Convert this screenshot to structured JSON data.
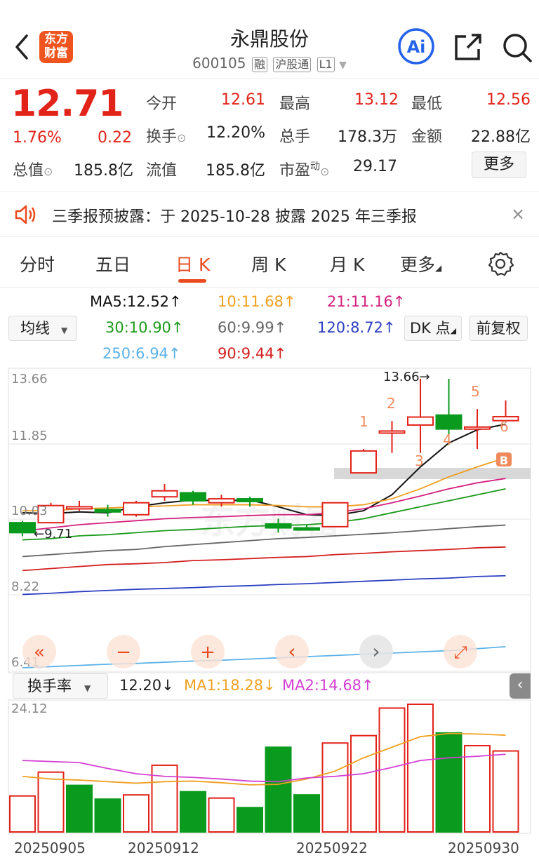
{
  "header": {
    "title": "永鼎股份",
    "code": "600105",
    "tags": [
      "融",
      "沪股通",
      "L1"
    ],
    "logo_text": [
      "东方",
      "财富"
    ],
    "icons": {
      "back": "back-arrow-icon",
      "ai": "ai-icon",
      "share": "share-icon",
      "search": "search-icon"
    }
  },
  "quote": {
    "price": "12.71",
    "change_pct": "1.76%",
    "change": "0.22",
    "open_label": "今开",
    "open": "12.61",
    "high_label": "最高",
    "high": "13.12",
    "low_label": "最低",
    "low": "12.56",
    "turnover_label": "换手",
    "turnover": "12.20%",
    "volume_label": "总手",
    "volume": "178.3万",
    "amount_label": "金额",
    "amount": "22.88亿",
    "mcap_label": "总值",
    "mcap": "185.8亿",
    "float_label": "流值",
    "float": "185.8亿",
    "pe_label": "市盈",
    "pe_sup": "动",
    "pe": "29.17",
    "more_label": "更多"
  },
  "notice": {
    "text": "三季报预披露：于 2025-10-28 披露 2025 年三季报",
    "close": "×"
  },
  "tabs": [
    "分时",
    "五日",
    "日 K",
    "周 K",
    "月 K",
    "更多"
  ],
  "active_tab": "日 K",
  "ma_legend": {
    "select_label": "均线",
    "dk_label": "DK 点",
    "adjust_label": "前复权",
    "items": [
      {
        "text": "MA5:12.52↑",
        "color": "#111111"
      },
      {
        "text": "10:11.68↑",
        "color": "#f0a020"
      },
      {
        "text": "21:11.16↑",
        "color": "#d4217e"
      },
      {
        "text": "30:10.90↑",
        "color": "#1a9a1a"
      },
      {
        "text": "60:9.99↑",
        "color": "#666666"
      },
      {
        "text": "120:8.72↑",
        "color": "#2b3fc0"
      },
      {
        "text": "250:6.94↑",
        "color": "#5bb2e8"
      },
      {
        "text": "90:9.44↑",
        "color": "#d32020"
      }
    ]
  },
  "chart_data": [
    {
      "type": "candlestick",
      "y_ticks": [
        "13.66",
        "11.85",
        "10.03",
        "8.22",
        "6.41"
      ],
      "annotations": {
        "max": "13.66→",
        "min": "←9.71"
      },
      "markers": [
        "1",
        "2",
        "3",
        "4",
        "5",
        "6",
        "B"
      ],
      "candles": [
        {
          "o": 10.05,
          "h": 10.1,
          "l": 9.71,
          "c": 9.8
        },
        {
          "o": 10.05,
          "h": 10.55,
          "l": 10.05,
          "c": 10.48
        },
        {
          "o": 10.4,
          "h": 10.6,
          "l": 10.35,
          "c": 10.45
        },
        {
          "o": 10.38,
          "h": 10.5,
          "l": 10.2,
          "c": 10.32
        },
        {
          "o": 10.25,
          "h": 10.6,
          "l": 10.2,
          "c": 10.55
        },
        {
          "o": 10.7,
          "h": 11.02,
          "l": 10.6,
          "c": 10.85
        },
        {
          "o": 10.8,
          "h": 10.85,
          "l": 10.5,
          "c": 10.6
        },
        {
          "o": 10.55,
          "h": 10.75,
          "l": 10.45,
          "c": 10.65
        },
        {
          "o": 10.65,
          "h": 10.7,
          "l": 10.45,
          "c": 10.58
        },
        {
          "o": 10.02,
          "h": 10.15,
          "l": 9.8,
          "c": 9.92
        },
        {
          "o": 9.92,
          "h": 10.0,
          "l": 9.85,
          "c": 9.88
        },
        {
          "o": 9.95,
          "h": 10.55,
          "l": 9.95,
          "c": 10.55
        },
        {
          "o": 11.3,
          "h": 11.9,
          "l": 11.35,
          "c": 11.85
        },
        {
          "o": 12.35,
          "h": 12.6,
          "l": 11.8,
          "c": 12.35
        },
        {
          "o": 12.5,
          "h": 13.66,
          "l": 11.8,
          "c": 12.7
        },
        {
          "o": 12.75,
          "h": 13.66,
          "l": 12.0,
          "c": 12.4
        },
        {
          "o": 12.45,
          "h": 12.9,
          "l": 11.9,
          "c": 12.45
        },
        {
          "o": 12.61,
          "h": 13.12,
          "l": 12.56,
          "c": 12.71
        }
      ],
      "ma": {
        "MA5": [
          10.3,
          10.28,
          10.32,
          10.3,
          10.45,
          10.55,
          10.62,
          10.6,
          10.62,
          10.45,
          10.25,
          10.23,
          10.35,
          10.75,
          11.45,
          12.05,
          12.38,
          12.52
        ],
        "MA10": [
          10.35,
          10.35,
          10.4,
          10.42,
          10.45,
          10.47,
          10.5,
          10.5,
          10.5,
          10.48,
          10.45,
          10.45,
          10.5,
          10.65,
          10.9,
          11.2,
          11.45,
          11.68
        ],
        "MA21": [
          9.84,
          9.92,
          10.0,
          10.05,
          10.1,
          10.15,
          10.18,
          10.2,
          10.23,
          10.25,
          10.25,
          10.3,
          10.4,
          10.55,
          10.72,
          10.9,
          11.05,
          11.16
        ],
        "MA30": [
          9.62,
          9.65,
          9.72,
          9.75,
          9.8,
          9.85,
          9.88,
          9.92,
          9.96,
          9.98,
          10.0,
          10.05,
          10.15,
          10.3,
          10.45,
          10.6,
          10.75,
          10.9
        ],
        "MA60": [
          9.2,
          9.25,
          9.3,
          9.35,
          9.38,
          9.45,
          9.5,
          9.55,
          9.6,
          9.65,
          9.68,
          9.72,
          9.76,
          9.8,
          9.85,
          9.9,
          9.95,
          9.99
        ],
        "MA90": [
          8.85,
          8.9,
          8.95,
          9.0,
          9.02,
          9.05,
          9.1,
          9.12,
          9.15,
          9.18,
          9.2,
          9.25,
          9.28,
          9.32,
          9.35,
          9.38,
          9.42,
          9.44
        ],
        "MA120": [
          8.25,
          8.28,
          8.32,
          8.35,
          8.38,
          8.4,
          8.42,
          8.45,
          8.47,
          8.5,
          8.52,
          8.55,
          8.58,
          8.61,
          8.64,
          8.66,
          8.7,
          8.72
        ],
        "MA250": [
          6.41,
          6.44,
          6.47,
          6.5,
          6.52,
          6.55,
          6.58,
          6.6,
          6.63,
          6.66,
          6.69,
          6.72,
          6.75,
          6.78,
          6.81,
          6.84,
          6.89,
          6.94
        ]
      },
      "ylim": [
        6.41,
        13.66
      ]
    },
    {
      "type": "bar",
      "select_label": "换手率",
      "legend": [
        {
          "text": "12.20↓",
          "color": "#222222"
        },
        {
          "text": "MA1:18.28↓",
          "color": "#f0a020"
        },
        {
          "text": "MA2:14.68↑",
          "color": "#d43fd4"
        }
      ],
      "y_tick": "24.12",
      "x_labels": [
        "20250905",
        "20250912",
        "20250922",
        "20250930"
      ],
      "values": [
        6.8,
        11.3,
        8.8,
        6.2,
        7.0,
        12.6,
        7.6,
        6.4,
        4.6,
        16.0,
        7.0,
        16.8,
        18.2,
        23.4,
        24.12,
        18.7,
        16.3,
        15.3
      ],
      "up": [
        true,
        true,
        false,
        false,
        true,
        true,
        false,
        true,
        false,
        false,
        false,
        true,
        true,
        true,
        true,
        false,
        true,
        true
      ],
      "ma1": [
        10.5,
        10.0,
        9.8,
        9.5,
        9.2,
        9.5,
        9.6,
        9.3,
        8.9,
        9.0,
        10.0,
        11.5,
        14.0,
        16.0,
        18.0,
        18.6,
        18.5,
        18.28
      ],
      "ma2": [
        13.5,
        13.3,
        13.1,
        12.0,
        11.0,
        10.5,
        10.3,
        10.0,
        9.6,
        9.5,
        10.2,
        10.5,
        11.0,
        12.2,
        13.5,
        14.0,
        14.3,
        14.68
      ],
      "ylim": [
        0,
        24.12
      ]
    }
  ],
  "controls": {
    "buttons": [
      "«",
      "−",
      "+",
      "‹",
      "›",
      "⤢"
    ],
    "side_toggle": "‹"
  },
  "colors": {
    "up": "#e2231a",
    "down": "#0a9a1d",
    "accent": "#ea4a1f"
  }
}
